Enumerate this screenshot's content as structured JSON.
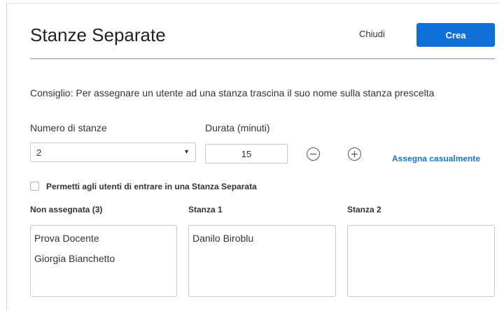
{
  "modal": {
    "title": "Stanze Separate",
    "close_label": "Chiudi",
    "create_label": "Crea"
  },
  "tip": "Consiglio: Per assegnare un utente ad una stanza trascina il suo nome sulla stanza prescelta",
  "rooms_count": {
    "label": "Numero di stanze",
    "selected": "2"
  },
  "duration": {
    "label": "Durata (minuti)",
    "value": "15",
    "decrease_icon": "minus-circle-icon",
    "increase_icon": "plus-circle-icon"
  },
  "random_assign_label": "Assegna casualmente",
  "allow_join": {
    "label": "Permetti agli utenti di entrare in una Stanza Separata",
    "checked": false
  },
  "columns": [
    {
      "title": "Non assegnata (3)",
      "users": [
        "Prova Docente",
        "Giorgia Bianchetto"
      ]
    },
    {
      "title": "Stanza 1",
      "users": [
        "Danilo Biroblu"
      ]
    },
    {
      "title": "Stanza 2",
      "users": []
    }
  ],
  "colors": {
    "accent": "#0f70d7",
    "link": "#1b74c8",
    "divider": "#b8c4cf"
  }
}
